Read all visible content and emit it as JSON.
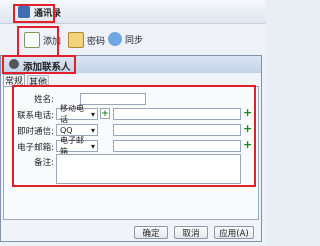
{
  "app": {
    "title": "通讯录"
  },
  "toolbar": {
    "add_label": "添加",
    "password_label": "密码",
    "sync_label": "同步"
  },
  "dialog": {
    "title": "添加联系人",
    "tabs": [
      "常规",
      "其他"
    ],
    "name_label": "姓名:",
    "phone_label": "联系电话:",
    "phone_type": "移动电话",
    "im_label": "即时通信:",
    "im_type": "QQ",
    "email_label": "电子邮箱:",
    "email_type": "电子邮箱",
    "note_label": "备注:",
    "ok_label": "确定",
    "cancel_label": "取消",
    "apply_label": "应用(A)"
  },
  "colors": {
    "highlight": "#e0202a",
    "plus": "#1e8a1e"
  }
}
